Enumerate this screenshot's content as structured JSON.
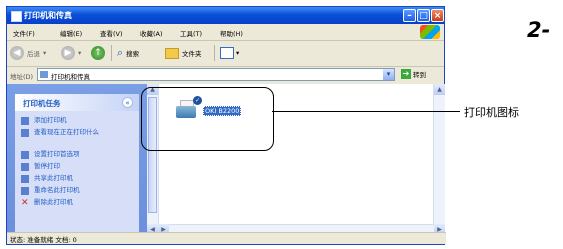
{
  "window": {
    "title": "打印机和传真",
    "buttons": {
      "minimize": "–",
      "maximize": "□",
      "close": "×"
    }
  },
  "menubar": [
    "文件(F)",
    "编辑(E)",
    "查看(V)",
    "收藏(A)",
    "工具(T)",
    "帮助(H)"
  ],
  "toolbar": {
    "back": "后退",
    "search": "搜索",
    "folders": "文件夹"
  },
  "address": {
    "label": "地址(D)",
    "value": "打印机和传真",
    "go": "转到"
  },
  "tasks": {
    "heading": "打印机任务",
    "items": [
      {
        "icon": "add-printer-icon",
        "label": "添加打印机"
      },
      {
        "icon": "queue-icon",
        "label": "查看现在正在打印什么"
      },
      {
        "icon": "preferences-icon",
        "label": "设置打印首选项"
      },
      {
        "icon": "pause-icon",
        "label": "暂停打印"
      },
      {
        "icon": "share-icon",
        "label": "共享此打印机"
      },
      {
        "icon": "rename-icon",
        "label": "重命名此打印机"
      },
      {
        "icon": "delete-icon",
        "label": "删除此打印机"
      }
    ]
  },
  "printer": {
    "name": "OKI B2200"
  },
  "statusbar": "状态: 准备就绪 文档: 0",
  "annotation": {
    "label": "打印机图标",
    "step": "2-"
  }
}
